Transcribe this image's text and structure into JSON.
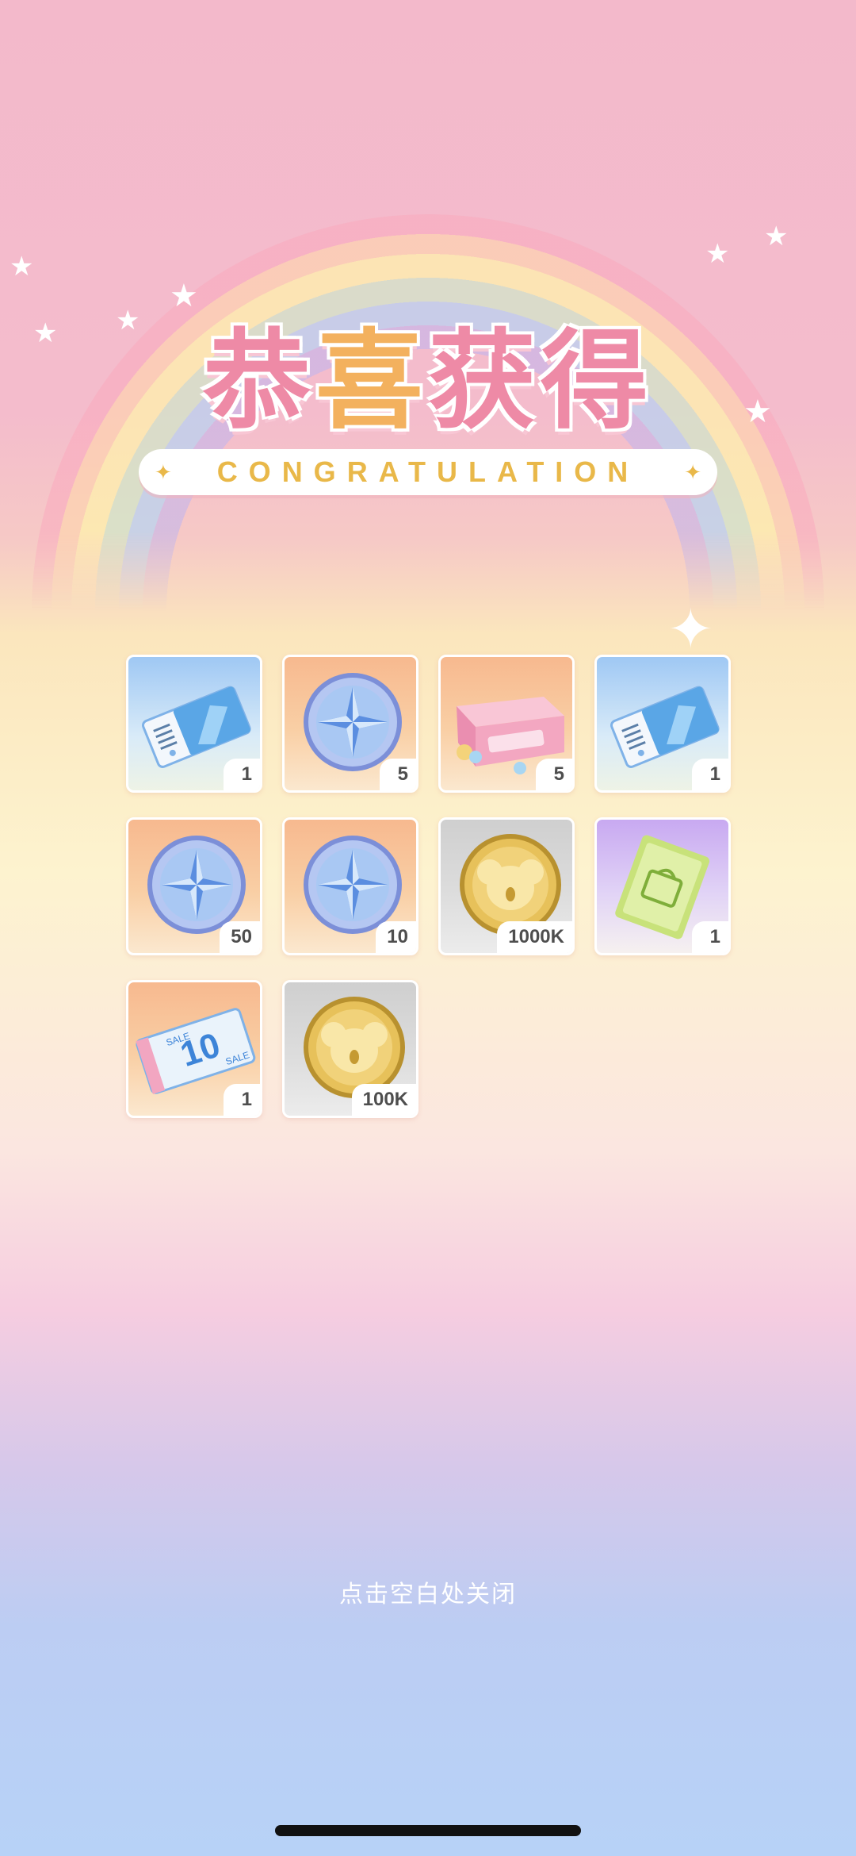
{
  "header": {
    "title_part1": "恭",
    "title_part2": "喜",
    "title_part3": "获",
    "title_part4": "得",
    "subtitle": "CONGRATULATION"
  },
  "rewards": [
    {
      "name": "ticket-blue-icon",
      "qty": "1",
      "bg": "blue"
    },
    {
      "name": "compass-medal-icon",
      "qty": "5",
      "bg": "orange"
    },
    {
      "name": "gift-box-icon",
      "qty": "5",
      "bg": "orange"
    },
    {
      "name": "ticket-blue-icon",
      "qty": "1",
      "bg": "blue"
    },
    {
      "name": "compass-medal-icon",
      "qty": "50",
      "bg": "orange"
    },
    {
      "name": "compass-medal-icon",
      "qty": "10",
      "bg": "orange"
    },
    {
      "name": "koala-gold-coin-icon",
      "qty": "1000K",
      "bg": "gray"
    },
    {
      "name": "green-bag-ticket-icon",
      "qty": "1",
      "bg": "purple"
    },
    {
      "name": "sale-10-coupon-icon",
      "qty": "1",
      "bg": "orange"
    },
    {
      "name": "koala-gold-coin-icon",
      "qty": "100K",
      "bg": "gray"
    }
  ],
  "footer": {
    "close_hint": "点击空白处关闭"
  },
  "colors": {
    "title_pink": "#ee8aa6",
    "title_gold": "#f3b15e",
    "banner_text": "#e9b849"
  }
}
